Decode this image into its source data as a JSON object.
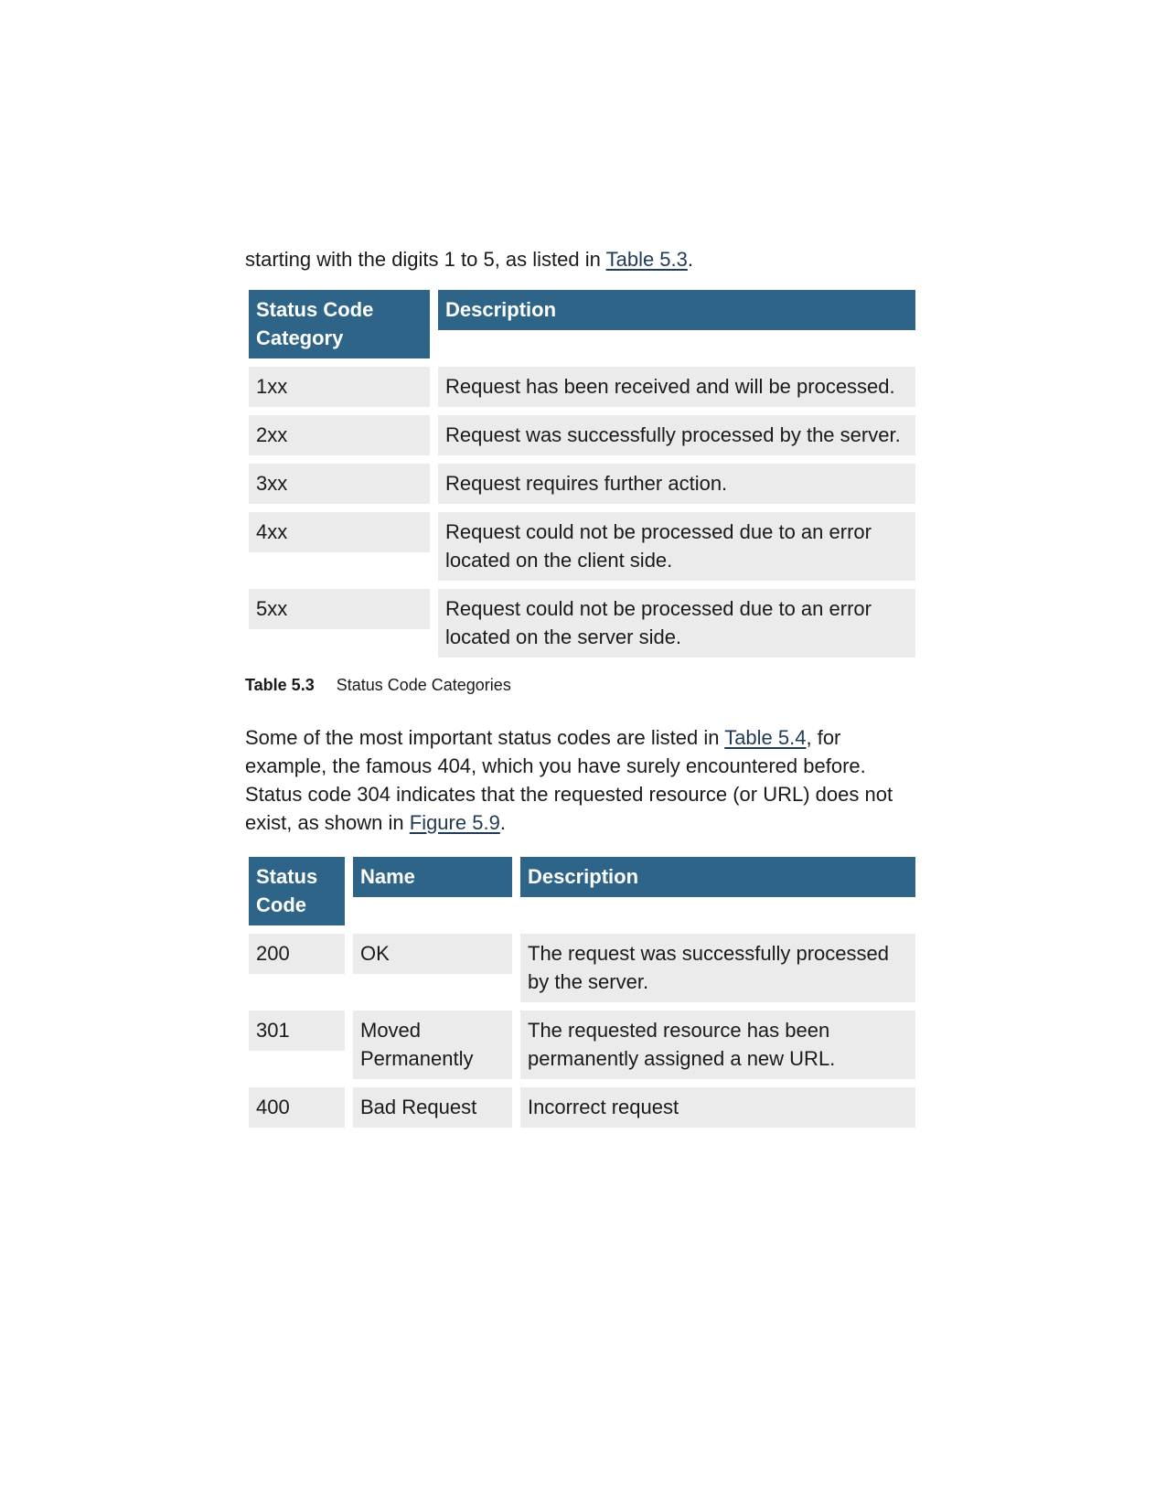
{
  "intro": {
    "text": "starting with the digits 1 to 5, as listed in ",
    "link": "Table 5.3",
    "end": "."
  },
  "table1": {
    "headers": [
      "Status Code Category",
      "Description"
    ],
    "rows": [
      [
        "1xx",
        "Request has been received and will be processed."
      ],
      [
        "2xx",
        "Request was successfully processed by the server."
      ],
      [
        "3xx",
        "Request requires further action."
      ],
      [
        "4xx",
        "Request could not be processed due to an error located on the client side."
      ],
      [
        "5xx",
        "Request could not be processed due to an error located on the server side."
      ]
    ],
    "caption_label": "Table 5.3",
    "caption_text": "Status Code Categories"
  },
  "para2": {
    "t1": "Some of the most important status codes are listed in ",
    "link1": "Table 5.4",
    "t2": ", for example, the famous 404, which you have surely encountered before. Status code 304 indicates that the requested resource (or URL) does not exist, as shown in ",
    "link2": "Figure 5.9",
    "t3": "."
  },
  "table2": {
    "headers": [
      "Status Code",
      "Name",
      "Description"
    ],
    "rows": [
      [
        "200",
        "OK",
        "The request was successfully processed by the server."
      ],
      [
        "301",
        "Moved Permanently",
        "The requested resource has been permanently assigned a new URL."
      ],
      [
        "400",
        "Bad Request",
        "Incorrect request"
      ]
    ]
  }
}
